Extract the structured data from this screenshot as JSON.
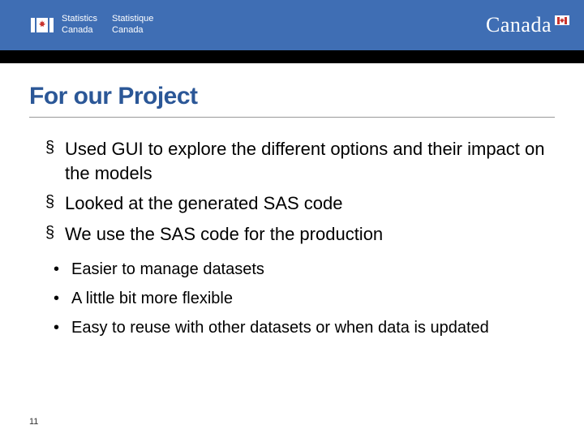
{
  "header": {
    "org_en_line1": "Statistics",
    "org_en_line2": "Canada",
    "org_fr_line1": "Statistique",
    "org_fr_line2": "Canada",
    "wordmark": "Canada"
  },
  "title": "For our Project",
  "bullets": [
    "Used GUI to explore the different options and their impact on the models",
    "Looked at the generated SAS code",
    "We use the SAS code for the production"
  ],
  "sub_bullets": [
    "Easier to manage datasets",
    "A little bit more flexible",
    "Easy to reuse with other datasets or when data is updated"
  ],
  "page_number": "11"
}
